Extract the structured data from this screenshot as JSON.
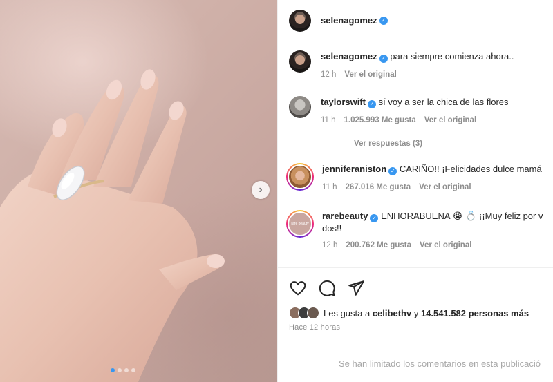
{
  "post": {
    "author": "selenagomez",
    "carousel": {
      "current": 1,
      "total": 4
    }
  },
  "icons": {
    "verified": "verified-badge-icon",
    "next": "chevron-right-icon",
    "like": "heart-icon",
    "comment": "comment-icon",
    "share": "paper-plane-icon"
  },
  "comments": [
    {
      "user": "selenagomez",
      "text": "para siempre comienza ahora..",
      "time": "12 h",
      "likes": "",
      "action": "Ver el original"
    },
    {
      "user": "taylorswift",
      "text": "sí voy a ser la chica de las flores",
      "time": "11 h",
      "likes": "1.025.993 Me gusta",
      "action": "Ver el original"
    },
    {
      "user": "jenniferaniston",
      "text": "CARIÑO!! ¡Felicidades dulce mamá",
      "time": "11 h",
      "likes": "267.016 Me gusta",
      "action": "Ver el original"
    },
    {
      "user": "rarebeauty",
      "text": "ENHORABUENA 😭 💍 ¡¡Muy feliz por v dos!!",
      "time": "12 h",
      "likes": "200.762 Me gusta",
      "action": "Ver el original"
    }
  ],
  "replies_label": "Ver respuestas (3)",
  "likes_summary": {
    "prefix": "Les gusta a",
    "user": "celibethv",
    "middle": "y",
    "count": "14.541.582 personas más"
  },
  "posted_time": "Hace 12 horas",
  "limited_comments": "Se han limitado los comentarios en esta publicació",
  "rare_avatar_text": "rare beauty",
  "colors": {
    "accent": "#3897f0",
    "muted": "#8e8e8e"
  }
}
